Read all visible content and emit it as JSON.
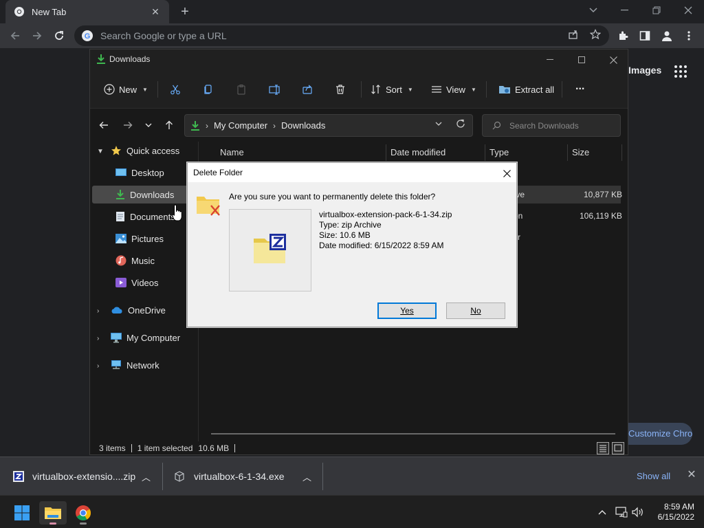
{
  "chrome": {
    "tab_title": "New Tab",
    "new_tab_label": "+",
    "omnibox_placeholder": "Search Google or type a URL",
    "ntp_images_link": "Images",
    "customize_chrome_label": "Customize Chrome"
  },
  "explorer": {
    "window_title": "Downloads",
    "commands": {
      "new_label": "New",
      "sort_label": "Sort",
      "view_label": "View",
      "extract_all_label": "Extract all",
      "more_label": "..."
    },
    "breadcrumb": [
      "My Computer",
      "Downloads"
    ],
    "search_placeholder": "Search Downloads",
    "nav": {
      "quick_access": "Quick access",
      "desktop": "Desktop",
      "downloads": "Downloads",
      "documents": "Documents",
      "pictures": "Pictures",
      "music": "Music",
      "videos": "Videos",
      "onedrive": "OneDrive",
      "my_computer": "My Computer",
      "network": "Network"
    },
    "columns": {
      "name": "Name",
      "date_modified": "Date modified",
      "type": "Type",
      "size": "Size"
    },
    "rows": [
      {
        "type_partial": "hive",
        "size": "10,877 KB"
      },
      {
        "type_partial": "tion",
        "size": "106,119 KB"
      },
      {
        "type_partial": "lier",
        "size": ""
      }
    ],
    "status": {
      "items": "3 items",
      "selected": "1 item selected",
      "size": "10.6 MB"
    }
  },
  "dialog": {
    "title": "Delete Folder",
    "question": "Are you sure you want to permanently delete this folder?",
    "file_name": "virtualbox-extension-pack-6-1-34.zip",
    "file_type": "Type: zip Archive",
    "file_size": "Size: 10.6 MB",
    "file_date": "Date modified: 6/15/2022 8:59 AM",
    "yes_label": "Yes",
    "no_label": "No"
  },
  "downloads_shelf": {
    "items": [
      {
        "name": "virtualbox-extensio....zip"
      },
      {
        "name": "virtualbox-6-1-34.exe"
      }
    ],
    "show_all_label": "Show all"
  },
  "taskbar": {
    "time": "8:59 AM",
    "date": "6/15/2022"
  },
  "colors": {
    "accent_blue": "#8ab4f8",
    "download_green": "#3fb950",
    "folder_yellow": "#f2c94c",
    "dialog_default_button": "#0078d7"
  }
}
